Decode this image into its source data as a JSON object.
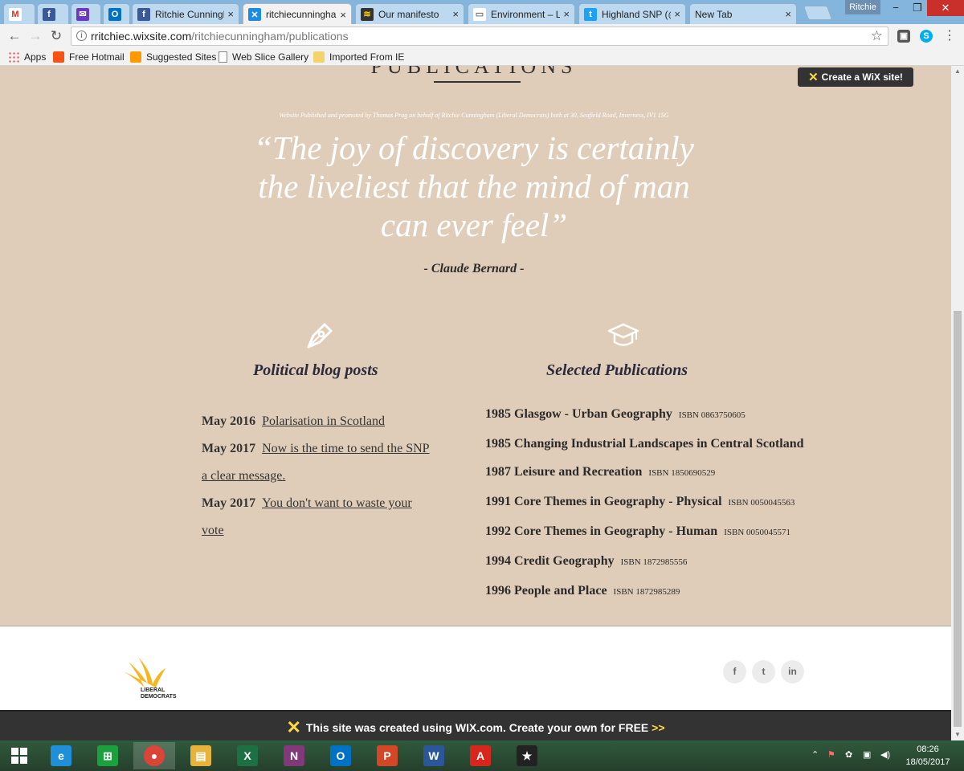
{
  "browser": {
    "tabs": [
      {
        "title": "",
        "icon": "gmail-icon",
        "glyph": "M",
        "color": "#d93025",
        "bg": "#ffffff"
      },
      {
        "title": "",
        "icon": "facebook-icon",
        "glyph": "f",
        "color": "#ffffff",
        "bg": "#3b5998"
      },
      {
        "title": "",
        "icon": "yahoo-mail-icon",
        "glyph": "✉",
        "color": "#ffffff",
        "bg": "#6a3bbf"
      },
      {
        "title": "",
        "icon": "outlook-icon",
        "glyph": "O",
        "color": "#ffffff",
        "bg": "#0072c6"
      },
      {
        "title": "Ritchie Cunningh",
        "icon": "facebook-icon",
        "glyph": "f",
        "color": "#ffffff",
        "bg": "#3b5998"
      },
      {
        "title": "ritchiecunningha",
        "icon": "wix-icon",
        "glyph": "✕",
        "color": "#ffffff",
        "bg": "#1d8ce0"
      },
      {
        "title": "Our manifesto",
        "icon": "libdem-icon",
        "glyph": "≋",
        "color": "#ffcc00",
        "bg": "#333333"
      },
      {
        "title": "Environment – Li",
        "icon": "page-icon",
        "glyph": "▭",
        "color": "#777777",
        "bg": "#ffffff"
      },
      {
        "title": "Highland SNP (@",
        "icon": "twitter-icon",
        "glyph": "t",
        "color": "#ffffff",
        "bg": "#1da1f2"
      },
      {
        "title": "New Tab",
        "icon": "",
        "glyph": "",
        "color": "#000000",
        "bg": "transparent"
      }
    ],
    "profile_name": "Ritchie",
    "url_host": "rritchiec.wixsite.com",
    "url_path": "/ritchiecunningham/publications",
    "bookmarks": [
      {
        "label": "Apps",
        "icon": "apps-grid-icon"
      },
      {
        "label": "Free Hotmail",
        "icon": "windows-flag-icon"
      },
      {
        "label": "Suggested Sites",
        "icon": "suggested-sites-icon"
      },
      {
        "label": "Web Slice Gallery",
        "icon": "page-icon"
      },
      {
        "label": "Imported From IE",
        "icon": "folder-icon"
      }
    ]
  },
  "site": {
    "heading_partial": "PUBLICATIONS",
    "wix_badge": "Create a WiX site!",
    "small_print": "Website Published and promoted by Thomas Prag on behalf of Ritchie Cunningham (Liberal Democrats) both at 30, Seafield Road, Inverness, IV1 1SG",
    "quote": "“The joy of discovery is certainly the liveliest that the mind of man can ever feel”",
    "quote_author": "- Claude Bernard -",
    "blog": {
      "title": "Political blog posts",
      "posts": [
        {
          "date": "May 2016",
          "title": "Polarisation in Scotland"
        },
        {
          "date": "May 2017",
          "title": "Now is the time to send the SNP a clear message."
        },
        {
          "date": "May 2017",
          "title": "You don't want to waste your vote"
        }
      ]
    },
    "publications": {
      "title": "Selected Publications",
      "items": [
        {
          "title": "1985 Glasgow - Urban Geography",
          "isbn": "ISBN 0863750605"
        },
        {
          "title": "1985 Changing Industrial Landscapes in Central Scotland",
          "isbn": ""
        },
        {
          "title": "1987 Leisure and Recreation",
          "isbn": "ISBN 1850690529"
        },
        {
          "title": "1991 Core Themes in Geography - Physical",
          "isbn": "ISBN 0050045563"
        },
        {
          "title": "1992 Core Themes in Geography - Human",
          "isbn": "ISBN 0050045571"
        },
        {
          "title": "1994 Credit Geography",
          "isbn": "ISBN 1872985556"
        },
        {
          "title": "1996 People and Place",
          "isbn": "ISBN 1872985289"
        }
      ]
    },
    "footer": {
      "logo_text_line1": "LIBERAL",
      "logo_text_line2": "DEMOCRATS",
      "social": [
        {
          "label": "f",
          "icon": "facebook-icon"
        },
        {
          "label": "t",
          "icon": "twitter-icon"
        },
        {
          "label": "in",
          "icon": "linkedin-icon"
        }
      ]
    },
    "wix_banner": {
      "text": "This site was created using WIX.com. Create your own for FREE",
      "arrow": ">>"
    }
  },
  "taskbar": {
    "apps": [
      {
        "icon": "internet-explorer-icon",
        "glyph": "e",
        "bg": "#1e8fd8"
      },
      {
        "icon": "windows-store-icon",
        "glyph": "⊞",
        "bg": "#1aa03c"
      },
      {
        "icon": "chrome-icon",
        "glyph": "●",
        "bg": "#db4437"
      },
      {
        "icon": "file-explorer-icon",
        "glyph": "▤",
        "bg": "#e8b33a"
      },
      {
        "icon": "excel-icon",
        "glyph": "X",
        "bg": "#1d7044"
      },
      {
        "icon": "onenote-icon",
        "glyph": "N",
        "bg": "#80397b"
      },
      {
        "icon": "outlook-icon",
        "glyph": "O",
        "bg": "#0072c6"
      },
      {
        "icon": "powerpoint-icon",
        "glyph": "P",
        "bg": "#d24726"
      },
      {
        "icon": "word-icon",
        "glyph": "W",
        "bg": "#2b579a"
      },
      {
        "icon": "acrobat-icon",
        "glyph": "A",
        "bg": "#d9261c"
      },
      {
        "icon": "movie-maker-icon",
        "glyph": "★",
        "bg": "#222222"
      }
    ],
    "time": "08:26",
    "date": "18/05/2017"
  }
}
